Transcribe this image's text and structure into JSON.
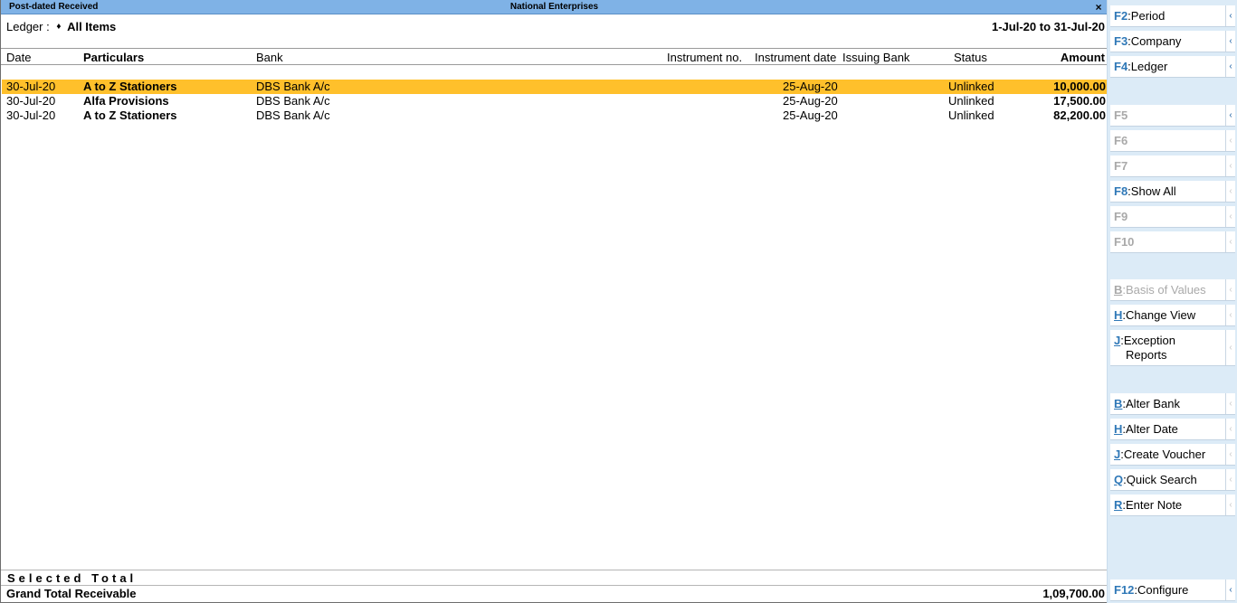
{
  "window": {
    "report_name": "Post-dated Received",
    "company": "National Enterprises",
    "close_glyph": "×"
  },
  "filter": {
    "ledger_label": "Ledger :",
    "diamond": "♦",
    "ledger_value": "All Items",
    "period": "1-Jul-20 to 31-Jul-20"
  },
  "columns": {
    "date": "Date",
    "particulars": "Particulars",
    "bank": "Bank",
    "instrument_no": "Instrument no.",
    "instrument_date": "Instrument date",
    "issuing_bank": "Issuing Bank",
    "status": "Status",
    "amount": "Amount"
  },
  "rows": [
    {
      "date": "30-Jul-20",
      "particulars": "A to Z Stationers",
      "bank": "DBS Bank A/c",
      "instrument_date": "25-Aug-20",
      "status": "Unlinked",
      "amount": "10,000.00",
      "selected": true
    },
    {
      "date": "30-Jul-20",
      "particulars": "Alfa Provisions",
      "bank": "DBS Bank A/c",
      "instrument_date": "25-Aug-20",
      "status": "Unlinked",
      "amount": "17,500.00",
      "selected": false
    },
    {
      "date": "30-Jul-20",
      "particulars": "A to Z Stationers",
      "bank": "DBS Bank A/c",
      "instrument_date": "25-Aug-20",
      "status": "Unlinked",
      "amount": "82,200.00",
      "selected": false
    }
  ],
  "footer": {
    "selected_total_label": "Selected Total",
    "grand_total_label": "Grand Total Receivable",
    "grand_total_amount": "1,09,700.00"
  },
  "sidebar": {
    "arrow_glyph": "‹",
    "buttons": [
      {
        "key": "F2",
        "label": "Period",
        "enabled": true
      },
      {
        "key": "F3",
        "label": "Company",
        "enabled": true
      },
      {
        "key": "F4",
        "label": "Ledger",
        "enabled": true
      },
      {
        "key": "F5",
        "label": "",
        "enabled": false
      },
      {
        "key": "F6",
        "label": "",
        "enabled": false
      },
      {
        "key": "F7",
        "label": "",
        "enabled": false
      },
      {
        "key": "F8",
        "label": "Show All",
        "enabled": true
      },
      {
        "key": "F9",
        "label": "",
        "enabled": false
      },
      {
        "key": "F10",
        "label": "",
        "enabled": false
      },
      {
        "key": "B",
        "label": "Basis of Values",
        "enabled": false
      },
      {
        "key": "H",
        "label": "Change View",
        "enabled": true
      },
      {
        "key": "J",
        "label": "Exception",
        "label2": "Reports",
        "enabled": true
      },
      {
        "key": "B",
        "label": "Alter Bank",
        "enabled": true
      },
      {
        "key": "H",
        "label": "Alter Date",
        "enabled": true
      },
      {
        "key": "J",
        "label": "Create Voucher",
        "enabled": true
      },
      {
        "key": "Q",
        "label": "Quick Search",
        "enabled": true
      },
      {
        "key": "R",
        "label": "Enter Note",
        "enabled": true
      },
      {
        "key": "F12",
        "label": "Configure",
        "enabled": true
      }
    ]
  }
}
